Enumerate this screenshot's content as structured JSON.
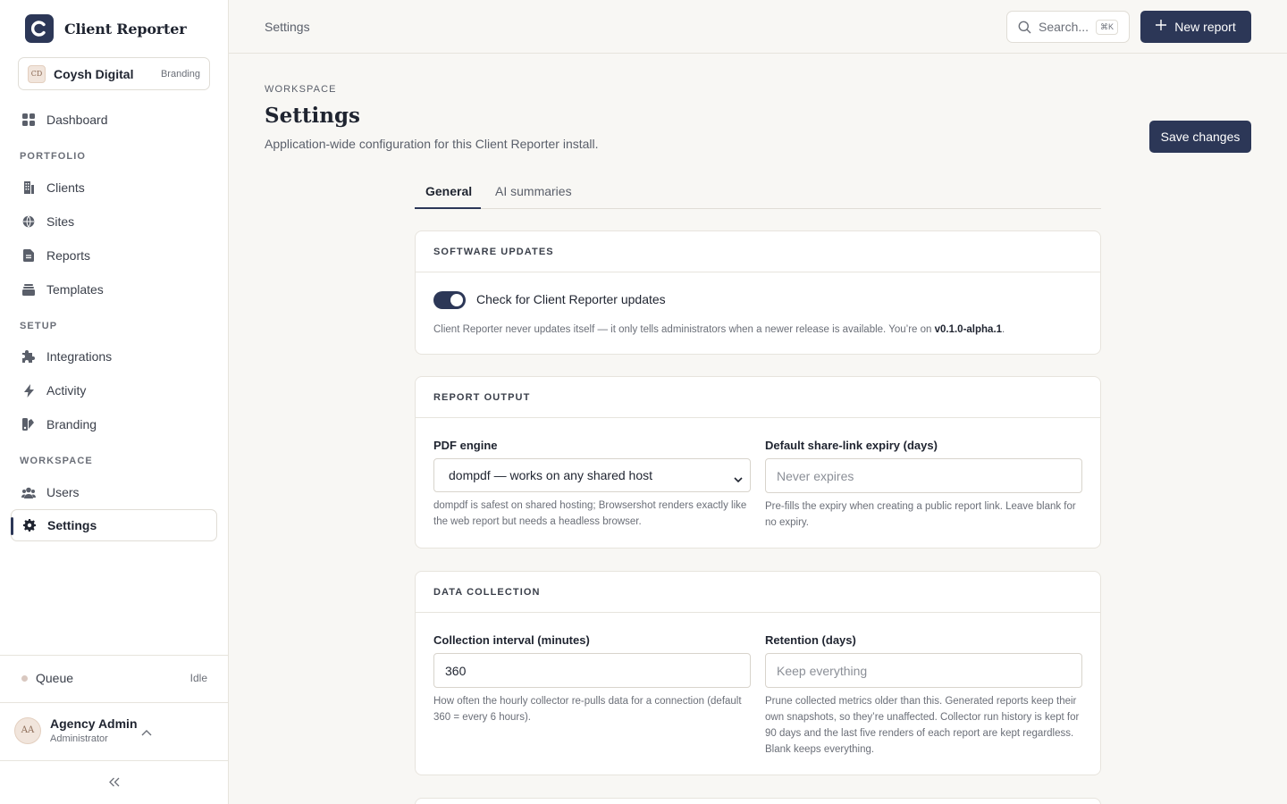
{
  "app": {
    "name": "Client Reporter"
  },
  "workspace": {
    "initials": "CD",
    "name": "Coysh Digital",
    "tag": "Branding"
  },
  "sidebar": {
    "dashboard": "Dashboard",
    "sections": {
      "portfolio": "PORTFOLIO",
      "setup": "SETUP",
      "workspace": "WORKSPACE"
    },
    "items": {
      "clients": "Clients",
      "sites": "Sites",
      "reports": "Reports",
      "templates": "Templates",
      "integrations": "Integrations",
      "activity": "Activity",
      "branding": "Branding",
      "users": "Users",
      "settings": "Settings"
    },
    "active": "settings",
    "queue": {
      "label": "Queue",
      "status": "Idle"
    },
    "user": {
      "initials": "AA",
      "name": "Agency Admin",
      "role": "Administrator"
    }
  },
  "topbar": {
    "breadcrumb": "Settings",
    "search_placeholder": "Search...",
    "search_shortcut": "⌘K",
    "new_report_label": "New report"
  },
  "page": {
    "eyebrow": "WORKSPACE",
    "title": "Settings",
    "subtitle": "Application-wide configuration for this Client Reporter install.",
    "save_label": "Save changes"
  },
  "tabs": [
    {
      "label": "General",
      "active": true
    },
    {
      "label": "AI summaries",
      "active": false
    }
  ],
  "software_updates": {
    "heading": "SOFTWARE UPDATES",
    "toggle_label": "Check for Client Reporter updates",
    "toggle_on": true,
    "help_prefix": "Client Reporter never updates itself — it only tells administrators when a newer release is available. You’re on ",
    "version": "v0.1.0-alpha.1",
    "help_suffix": "."
  },
  "report_output": {
    "heading": "REPORT OUTPUT",
    "pdf_label": "PDF engine",
    "pdf_value": "dompdf — works on any shared host",
    "pdf_help": "dompdf is safest on shared hosting; Browsershot renders exactly like the web report but needs a headless browser.",
    "expiry_label": "Default share-link expiry (days)",
    "expiry_placeholder": "Never expires",
    "expiry_help": "Pre-fills the expiry when creating a public report link. Leave blank for no expiry."
  },
  "data_collection": {
    "heading": "DATA COLLECTION",
    "interval_label": "Collection interval (minutes)",
    "interval_value": "360",
    "interval_help": "How often the hourly collector re-pulls data for a connection (default 360 = every 6 hours).",
    "retention_label": "Retention (days)",
    "retention_placeholder": "Keep everything",
    "retention_help": "Prune collected metrics older than this. Generated reports keep their own snapshots, so they’re unaffected. Collector run history is kept for 90 days and the last five renders of each report are kept regardless. Blank keeps everything."
  },
  "colors": {
    "accent": "#2c3757",
    "background": "#f8f7f4",
    "border": "#e7e4dd"
  }
}
